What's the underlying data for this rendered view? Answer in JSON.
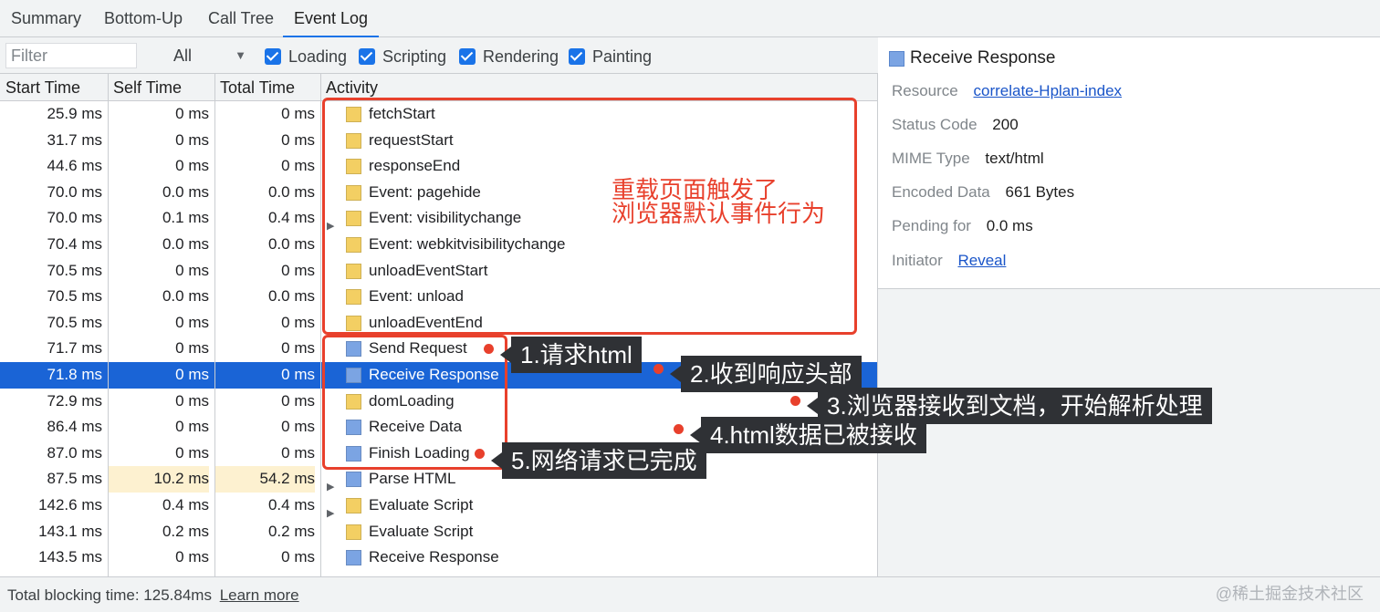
{
  "tabs": [
    "Summary",
    "Bottom-Up",
    "Call Tree",
    "Event Log"
  ],
  "toolbar": {
    "filter_placeholder": "Filter",
    "filter_select": "All",
    "checkboxes": [
      "Loading",
      "Scripting",
      "Rendering",
      "Painting"
    ]
  },
  "columns": [
    "Start Time",
    "Self Time",
    "Total Time",
    "Activity"
  ],
  "colors": {
    "loading_yellow": "#f3cf63",
    "network_blue": "#7ba4e3",
    "selection_blue": "#1a64d6",
    "annotation_red": "#e8402c"
  },
  "rows": [
    {
      "start": "25.9 ms",
      "self": "0 ms",
      "total": "0 ms",
      "activity": "fetchStart",
      "color": "#f3cf63",
      "expandable": false
    },
    {
      "start": "31.7 ms",
      "self": "0 ms",
      "total": "0 ms",
      "activity": "requestStart",
      "color": "#f3cf63",
      "expandable": false
    },
    {
      "start": "44.6 ms",
      "self": "0 ms",
      "total": "0 ms",
      "activity": "responseEnd",
      "color": "#f3cf63",
      "expandable": false
    },
    {
      "start": "70.0 ms",
      "self": "0.0 ms",
      "total": "0.0 ms",
      "activity": "Event: pagehide",
      "color": "#f3cf63",
      "expandable": false
    },
    {
      "start": "70.0 ms",
      "self": "0.1 ms",
      "total": "0.4 ms",
      "activity": "Event: visibilitychange",
      "color": "#f3cf63",
      "expandable": true
    },
    {
      "start": "70.4 ms",
      "self": "0.0 ms",
      "total": "0.0 ms",
      "activity": "Event: webkitvisibilitychange",
      "color": "#f3cf63",
      "expandable": false
    },
    {
      "start": "70.5 ms",
      "self": "0 ms",
      "total": "0 ms",
      "activity": "unloadEventStart",
      "color": "#f3cf63",
      "expandable": false
    },
    {
      "start": "70.5 ms",
      "self": "0.0 ms",
      "total": "0.0 ms",
      "activity": "Event: unload",
      "color": "#f3cf63",
      "expandable": false
    },
    {
      "start": "70.5 ms",
      "self": "0 ms",
      "total": "0 ms",
      "activity": "unloadEventEnd",
      "color": "#f3cf63",
      "expandable": false
    },
    {
      "start": "71.7 ms",
      "self": "0 ms",
      "total": "0 ms",
      "activity": "Send Request",
      "color": "#7ba4e3",
      "expandable": false
    },
    {
      "start": "71.8 ms",
      "self": "0 ms",
      "total": "0 ms",
      "activity": "Receive Response",
      "color": "#7ba4e3",
      "expandable": false,
      "selected": true
    },
    {
      "start": "72.9 ms",
      "self": "0 ms",
      "total": "0 ms",
      "activity": "domLoading",
      "color": "#f3cf63",
      "expandable": false
    },
    {
      "start": "86.4 ms",
      "self": "0 ms",
      "total": "0 ms",
      "activity": "Receive Data",
      "color": "#7ba4e3",
      "expandable": false
    },
    {
      "start": "87.0 ms",
      "self": "0 ms",
      "total": "0 ms",
      "activity": "Finish Loading",
      "color": "#7ba4e3",
      "expandable": false
    },
    {
      "start": "87.5 ms",
      "self": "10.2 ms",
      "total": "54.2 ms",
      "activity": "Parse HTML",
      "color": "#7ba4e3",
      "expandable": true,
      "hot": true
    },
    {
      "start": "142.6 ms",
      "self": "0.4 ms",
      "total": "0.4 ms",
      "activity": "Evaluate Script",
      "color": "#f3cf63",
      "expandable": true
    },
    {
      "start": "143.1 ms",
      "self": "0.2 ms",
      "total": "0.2 ms",
      "activity": "Evaluate Script",
      "color": "#f3cf63",
      "expandable": false
    },
    {
      "start": "143.5 ms",
      "self": "0 ms",
      "total": "0 ms",
      "activity": "Receive Response",
      "color": "#7ba4e3",
      "expandable": false
    }
  ],
  "details": {
    "title": "Receive Response",
    "resource_label": "Resource",
    "resource_value": "correlate-Hplan-index",
    "status_label": "Status Code",
    "status_value": "200",
    "mime_label": "MIME Type",
    "mime_value": "text/html",
    "encoded_label": "Encoded Data",
    "encoded_value": "661 Bytes",
    "pending_label": "Pending for",
    "pending_value": "0.0 ms",
    "initiator_label": "Initiator",
    "initiator_value": "Reveal"
  },
  "footer": {
    "blocking_time": "Total blocking time: 125.84ms",
    "learn_more": "Learn more"
  },
  "watermark": "@稀土掘金技术社区",
  "annotations": {
    "reload_note_line1": "重载页面触发了",
    "reload_note_line2": "浏览器默认事件行为",
    "step1": "1.请求html",
    "step2": "2.收到响应头部",
    "step3": "3.浏览器接收到文档，开始解析处理",
    "step4": "4.html数据已被接收",
    "step5": "5.网络请求已完成"
  }
}
